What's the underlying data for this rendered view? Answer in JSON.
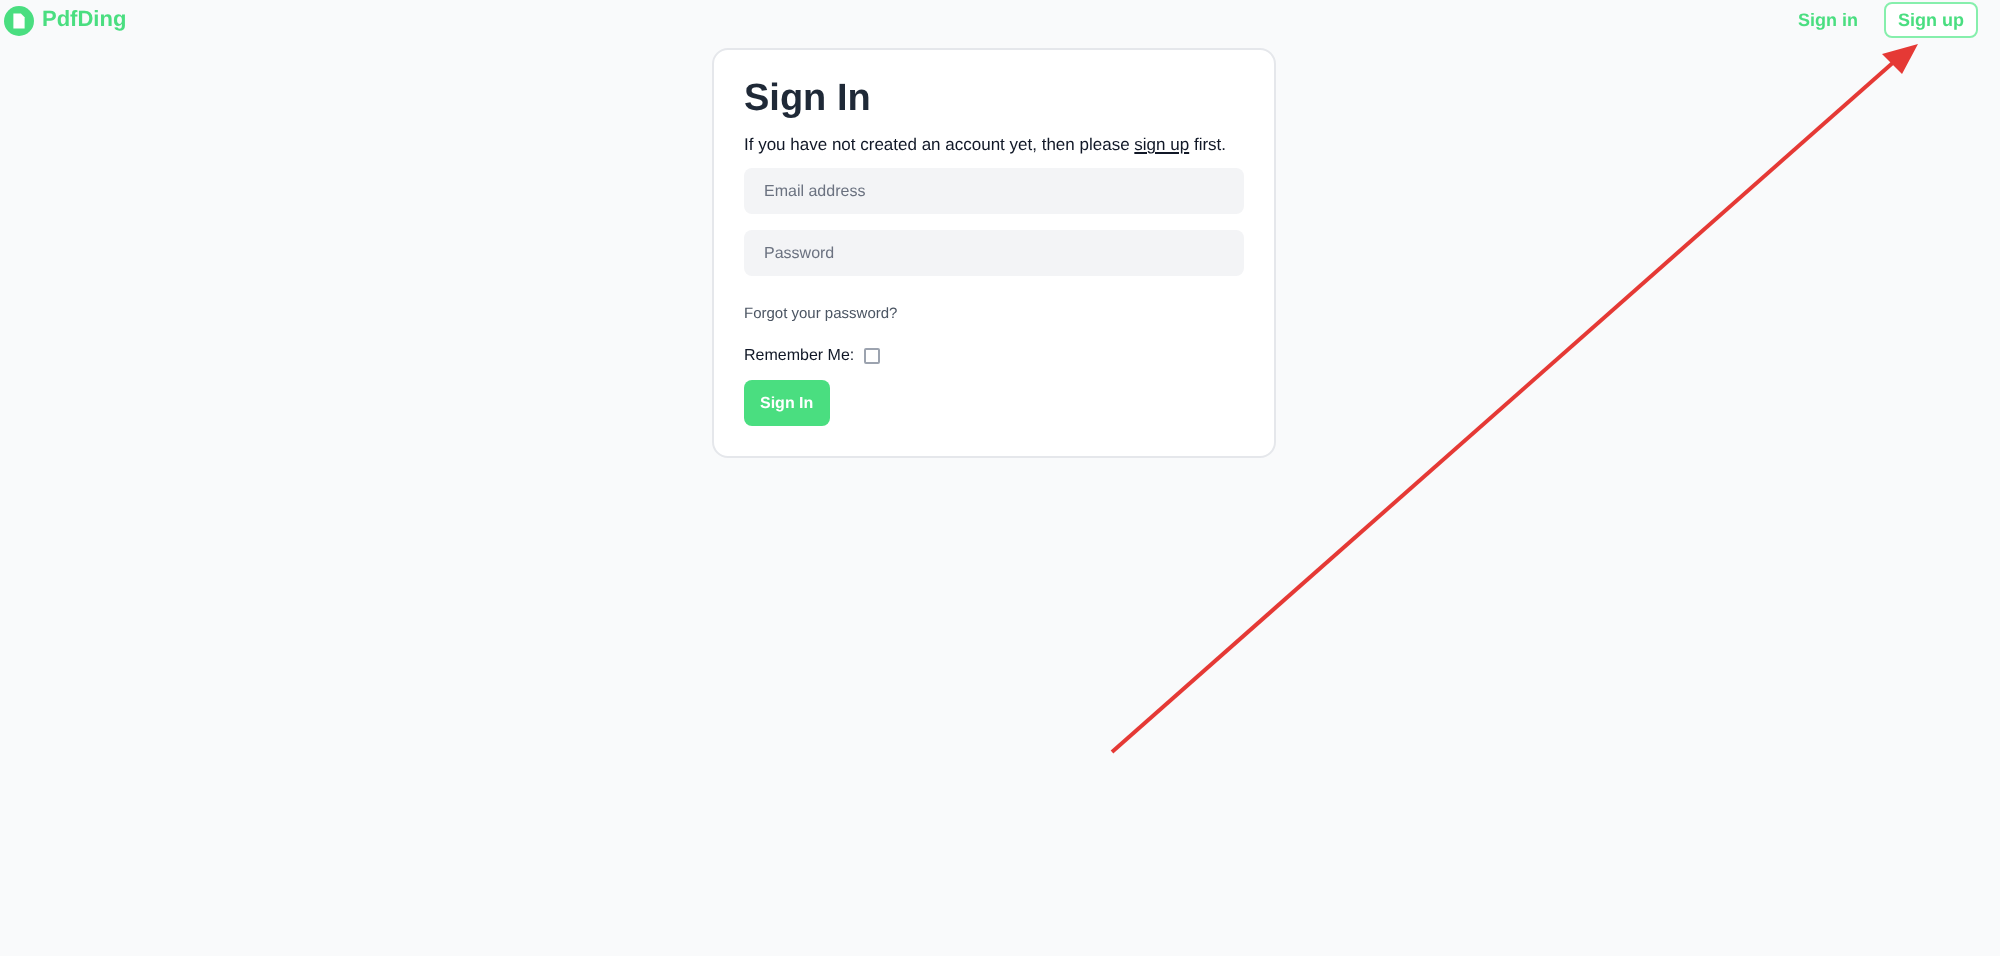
{
  "header": {
    "logo": "PdfDing",
    "nav": [
      {
        "label": "Sign in",
        "kind": "link"
      },
      {
        "label": "Sign up",
        "kind": "outlined"
      }
    ]
  },
  "card": {
    "title": "Sign In",
    "intro": {
      "before": "If you have not created an account yet, then please ",
      "link": "sign up",
      "after": " first."
    },
    "fields": [
      {
        "placeholder": "Email address"
      },
      {
        "placeholder": "Password"
      }
    ],
    "forgot_link": "Forgot your password?",
    "remember": {
      "label": "Remember Me:",
      "checked": false
    },
    "submit": "Sign In"
  }
}
